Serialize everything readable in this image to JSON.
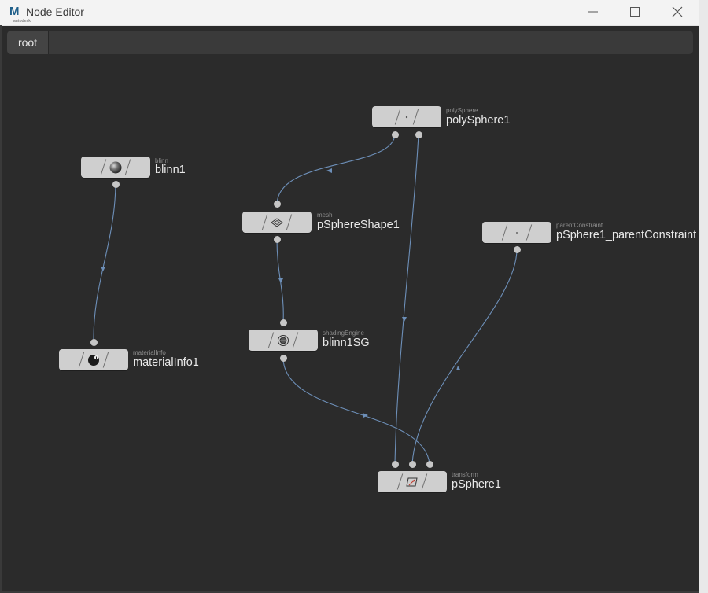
{
  "window": {
    "title": "Node Editor",
    "app_icon_letter": "M",
    "app_icon_caption": "autodesk"
  },
  "breadcrumb": {
    "root": "root"
  },
  "nodes": {
    "polySphere1": {
      "type": "polySphere",
      "name": "polySphere1"
    },
    "blinn1": {
      "type": "blinn",
      "name": "blinn1"
    },
    "pSphereShape1": {
      "type": "mesh",
      "name": "pSphereShape1"
    },
    "parentConstraint": {
      "type": "parentConstraint",
      "name": "pSphere1_parentConstraint"
    },
    "blinn1SG": {
      "type": "shadingEngine",
      "name": "blinn1SG"
    },
    "materialInfo1": {
      "type": "materialInfo",
      "name": "materialInfo1"
    },
    "pSphere1": {
      "type": "transform",
      "name": "pSphere1"
    }
  },
  "colors": {
    "canvas": "#2b2b2b",
    "node": "#cfcfcf",
    "wire": "#6d8fb8",
    "port": "#c6c6c6"
  }
}
